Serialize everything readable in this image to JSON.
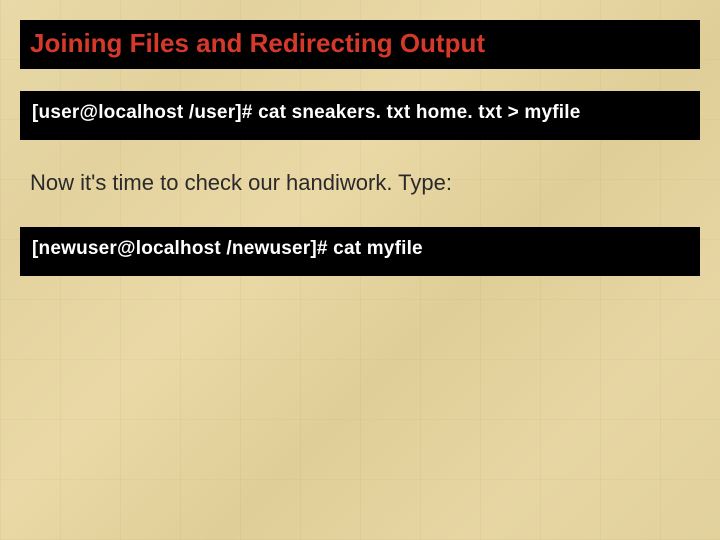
{
  "slide": {
    "title": "Joining Files and Redirecting Output",
    "terminal1": {
      "prompt": "[user@localhost /user]#",
      "command": "cat sneakers. txt home. txt > myfile"
    },
    "body1": "Now it's time to check our handiwork. Type:",
    "terminal2": {
      "prompt": "[newuser@localhost /newuser]#",
      "command": "cat myfile"
    }
  }
}
